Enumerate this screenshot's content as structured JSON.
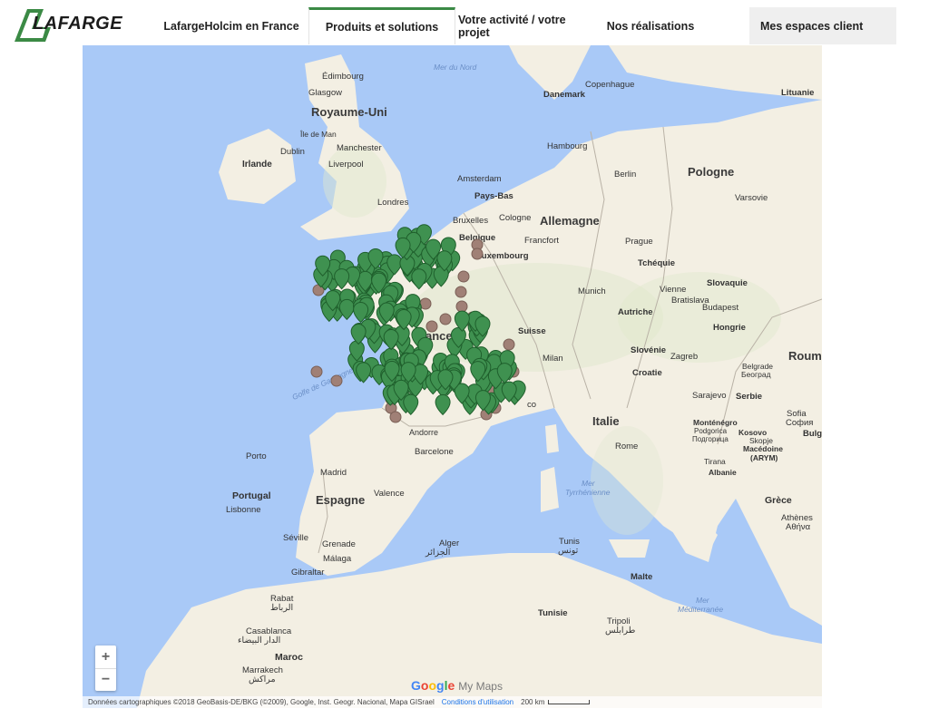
{
  "header": {
    "logo_text": "LAFARGE",
    "nav": [
      {
        "label": "LafargeHolcim en France"
      },
      {
        "label": "Produits et solutions"
      },
      {
        "label": "Votre activité / votre projet"
      },
      {
        "label": "Nos réalisations"
      },
      {
        "label": "Mes espaces client"
      }
    ]
  },
  "map": {
    "countries": {
      "uk": "Royaume-Uni",
      "ireland": "Irlande",
      "france": "France",
      "spain": "Espagne",
      "portugal": "Portugal",
      "italy": "Italie",
      "germany": "Allemagne",
      "poland": "Pologne",
      "lithuania": "Lituanie",
      "czech": "Tchéquie",
      "slovakia": "Slovaquie",
      "austria": "Autriche",
      "hungary": "Hongrie",
      "slovenia": "Slovénie",
      "croatia": "Croatie",
      "serbia": "Serbie",
      "montenegro": "Monténégro",
      "kosovo": "Kosovo",
      "albania": "Albanie",
      "macedonia": "Macédoine",
      "macedonia2": "(ARYM)",
      "bulgaria": "Bulg",
      "romania": "Roum",
      "greece": "Grèce",
      "switzerland": "Suisse",
      "denmark": "Danemark",
      "belgium": "Belgique",
      "netherlands": "Pays-Bas",
      "luxembourg": "Luxembourg",
      "tunisia": "Tunisie",
      "morocco": "Maroc",
      "malta": "Malte",
      "andorra": "Andorre"
    },
    "seas": {
      "north": "Mer du Nord",
      "gascogne": "Golfe de Gascogne",
      "tyrrhenian1": "Mer",
      "tyrrhenian2": "Tyrrhénienne",
      "med1": "Mer",
      "med2": "Méditerranée"
    },
    "cities": {
      "edinburgh": "Édimbourg",
      "glasgow": "Glasgow",
      "isle_of_man": "Île de Man",
      "dublin": "Dublin",
      "manchester": "Manchester",
      "liverpool": "Liverpool",
      "london": "Londres",
      "amsterdam": "Amsterdam",
      "brussels": "Bruxelles",
      "cologne": "Cologne",
      "hamburg": "Hambourg",
      "berlin": "Berlin",
      "copenhagen": "Copenhague",
      "warsaw": "Varsovie",
      "prague": "Prague",
      "frankfurt": "Francfort",
      "munich": "Munich",
      "vienna": "Vienne",
      "bratislava": "Bratislava",
      "budapest": "Budapest",
      "milan": "Milan",
      "zagreb": "Zagreb",
      "belgrade1": "Belgrade",
      "belgrade2": "Београд",
      "sarajevo": "Sarajevo",
      "podgorica1": "Podgorica",
      "podgorica2": "Подгорица",
      "sofia1": "Sofia",
      "sofia2": "София",
      "skopje": "Skopje",
      "tirana": "Tirana",
      "athens1": "Athènes",
      "athens2": "Αθήνα",
      "rome": "Rome",
      "barcelona": "Barcelone",
      "madrid": "Madrid",
      "valencia": "Valence",
      "porto": "Porto",
      "lisbon": "Lisbonne",
      "seville": "Séville",
      "grenade": "Grenade",
      "malaga": "Málaga",
      "gibraltar": "Gibraltar",
      "algiers1": "Alger",
      "algiers2": "الجزائر",
      "tunis1": "Tunis",
      "tunis2": "تونس",
      "rabat1": "Rabat",
      "rabat2": "الرباط",
      "casablanca1": "Casablanca",
      "casablanca2": "الدار البيضاء",
      "marrakech1": "Marrakech",
      "marrakech2": "مراكش",
      "tripoli1": "Tripoli",
      "tripoli2": "طرابلس",
      "monaco": "co"
    },
    "zoom_in": "+",
    "zoom_out": "−",
    "google": {
      "G": "G",
      "o1": "o",
      "o2": "o",
      "g": "g",
      "l": "l",
      "e": "e",
      "mymaps": "My Maps"
    },
    "attribution": "Données cartographiques ©2018 GeoBasis-DE/BKG (©2009), Google, Inst. Geogr. Nacional, Mapa GISrael",
    "terms": "Conditions d'utilisation",
    "scale": "200 km",
    "colors": {
      "sea": "#a9c9f7",
      "land": "#f3efe3",
      "marker_green": "#3f9150",
      "marker_brown": "#a08076"
    }
  }
}
